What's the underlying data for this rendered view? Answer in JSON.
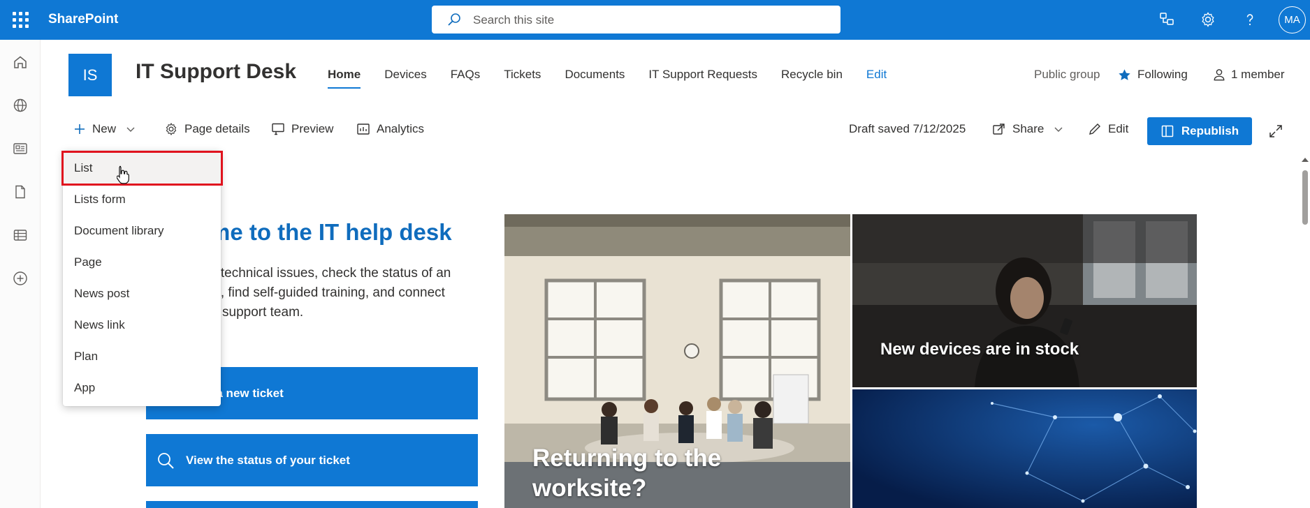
{
  "suitebar": {
    "app_name": "SharePoint",
    "search_placeholder": "Search this site",
    "avatar_initials": "MA"
  },
  "site": {
    "logo_initials": "IS",
    "title": "IT Support Desk",
    "nav": [
      {
        "label": "Home",
        "active": true
      },
      {
        "label": "Devices"
      },
      {
        "label": "FAQs"
      },
      {
        "label": "Tickets"
      },
      {
        "label": "Documents"
      },
      {
        "label": "IT Support Requests"
      },
      {
        "label": "Recycle bin"
      },
      {
        "label": "Edit"
      }
    ],
    "group_type": "Public group",
    "following_label": "Following",
    "members_label": "1 member"
  },
  "commandbar": {
    "new_label": "New",
    "page_details_label": "Page details",
    "preview_label": "Preview",
    "analytics_label": "Analytics",
    "draft_status": "Draft saved 7/12/2025",
    "share_label": "Share",
    "edit_label": "Edit",
    "republish_label": "Republish"
  },
  "new_menu": {
    "items": [
      "List",
      "Lists form",
      "Document library",
      "Page",
      "News post",
      "News link",
      "Plan",
      "App"
    ],
    "selected": "List"
  },
  "content": {
    "welcome_visible": "me to the IT help desk",
    "desc_lines": [
      "n technical issues, check the status of an",
      "et, find self-guided training, and connect",
      "support team."
    ],
    "cta_buttons": [
      "t a new ticket",
      "View the status of your ticket"
    ],
    "tiles": {
      "big": "Returning to the worksite?",
      "big_line1": "Returning to the",
      "big_line2": "worksite?",
      "right_top": "New devices are in stock"
    }
  },
  "colors": {
    "brand": "#0f78d4",
    "highlight": "#e0131e"
  }
}
